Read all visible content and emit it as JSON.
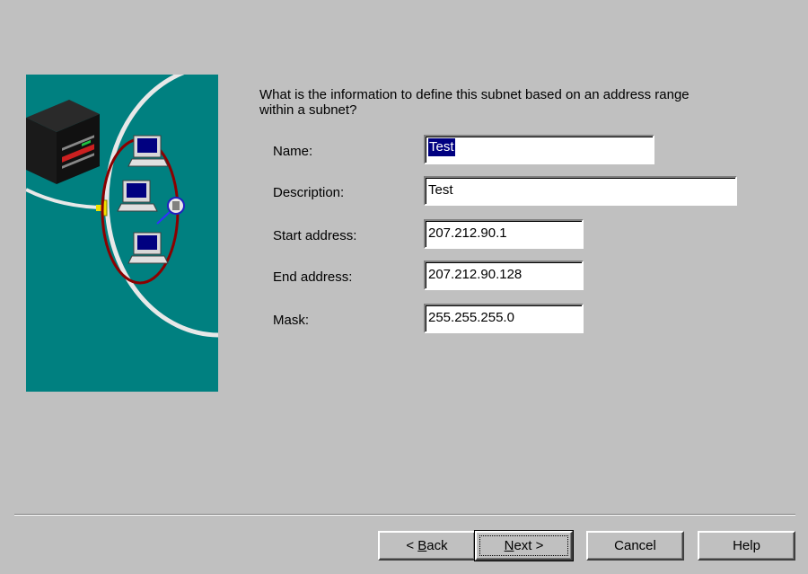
{
  "prompt": {
    "text": "What is the information to define this subnet based on an address range within a subnet?"
  },
  "fields": {
    "name": {
      "label": "Name:",
      "value": "Test",
      "selected": true
    },
    "description": {
      "label": "Description:",
      "value": "Test"
    },
    "start_address": {
      "label": "Start address:",
      "value": "207.212.90.1"
    },
    "end_address": {
      "label": "End address:",
      "value": "207.212.90.128"
    },
    "mask": {
      "label": "Mask:",
      "value": "255.255.255.0"
    }
  },
  "buttons": {
    "back": {
      "prefix": "< ",
      "accel": "B",
      "rest": "ack"
    },
    "next": {
      "accel": "N",
      "rest": "ext >"
    },
    "cancel": {
      "label": "Cancel"
    },
    "help": {
      "label": "Help"
    }
  },
  "illustration": {
    "icons": [
      "server-icon",
      "computer-icon",
      "computer-icon",
      "computer-icon",
      "magnifier-icon"
    ]
  },
  "colors": {
    "dialog_bg": "#c0c0c0",
    "illustration_bg": "#008080",
    "selection": "#000080",
    "subnet_ring": "#8b0000"
  }
}
